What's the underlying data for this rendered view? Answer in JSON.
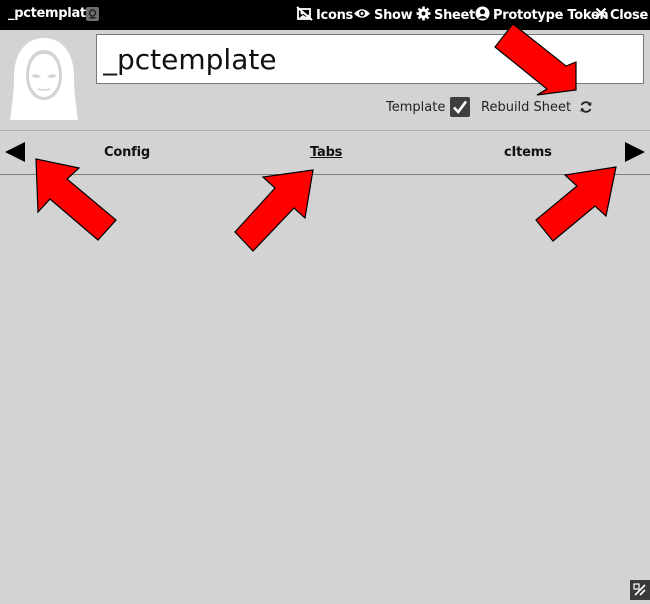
{
  "window": {
    "title": "_pctemplate",
    "buttons": {
      "icons": "Icons",
      "show": "Show",
      "sheet": "Sheet",
      "prototype_token": "Prototype Token",
      "close": "Close"
    }
  },
  "sheet": {
    "name_value": "_pctemplate",
    "template_label": "Template",
    "template_checked": true,
    "rebuild_label": "Rebuild Sheet"
  },
  "tabs": {
    "items": [
      "Config",
      "Tabs",
      "cItems"
    ],
    "active": "Tabs"
  },
  "colors": {
    "titlebar": "#000000",
    "background": "#d3d3d3",
    "annotation_arrow": "#ff0000"
  }
}
